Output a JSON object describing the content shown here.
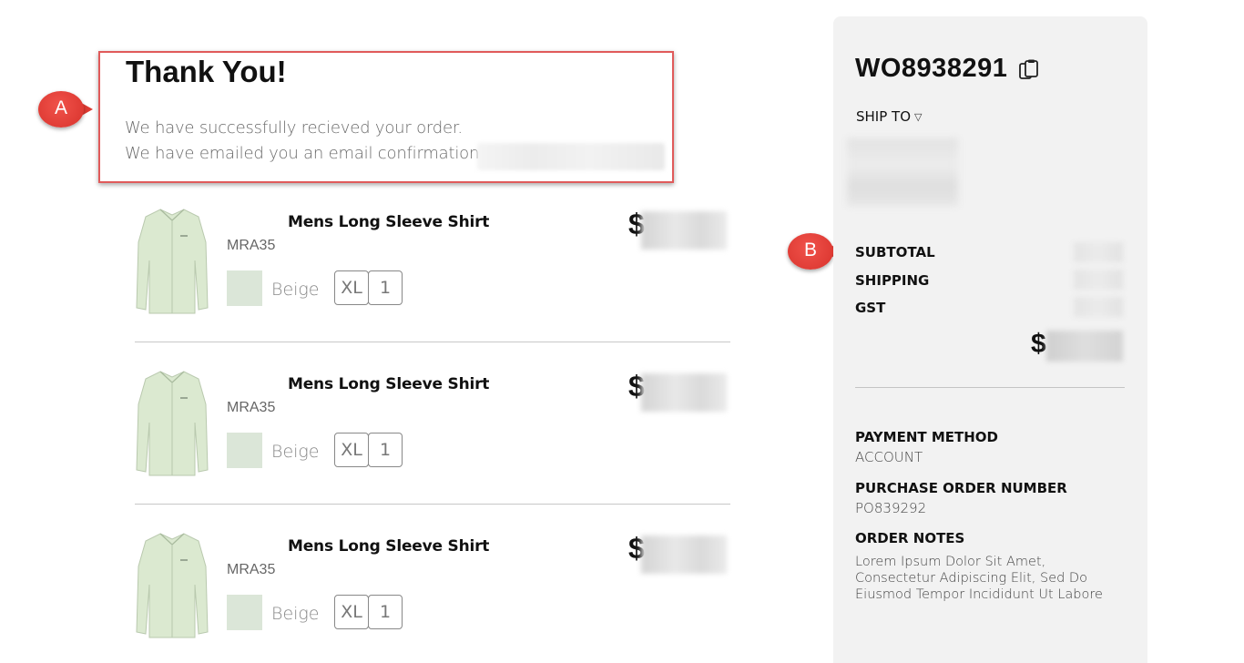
{
  "thanks": {
    "title": "Thank You!",
    "line1": "We have successfully recieved your order.",
    "line2": "We have emailed you an email confirmation to"
  },
  "callouts": {
    "a": "A",
    "b": "B"
  },
  "products": [
    {
      "name": "Mens Long Sleeve Shirt",
      "sku": "MRA35",
      "color": "Beige",
      "size": "XL",
      "qty": "1",
      "currency": "$"
    },
    {
      "name": "Mens Long Sleeve Shirt",
      "sku": "MRA35",
      "color": "Beige",
      "size": "XL",
      "qty": "1",
      "currency": "$"
    },
    {
      "name": "Mens Long Sleeve Shirt",
      "sku": "MRA35",
      "color": "Beige",
      "size": "XL",
      "qty": "1",
      "currency": "$"
    }
  ],
  "sidebar": {
    "order_id": "WO8938291",
    "ship_to_label": "SHIP TO",
    "subtotal_label": "SUBTOTAL",
    "shipping_label": "SHIPPING",
    "gst_label": "GST",
    "total_currency": "$",
    "payment_method_label": "PAYMENT METHOD",
    "payment_method_value": "ACCOUNT",
    "po_label": "PURCHASE ORDER NUMBER",
    "po_value": "PO839292",
    "order_notes_label": "ORDER NOTES",
    "order_notes_value": "Lorem Ipsum Dolor Sit Amet, Consectetur Adipiscing Elit, Sed Do Eiusmod Tempor Incididunt Ut Labore"
  },
  "icons": {
    "copy": "copy-icon",
    "caret": "caret-down-icon",
    "shirt": "shirt-image"
  },
  "colors": {
    "highlight_border": "#e05a5a",
    "callout": "#e0403a",
    "swatch_beige": "#dbe6d8",
    "sidebar_bg": "#f2f2f2"
  }
}
